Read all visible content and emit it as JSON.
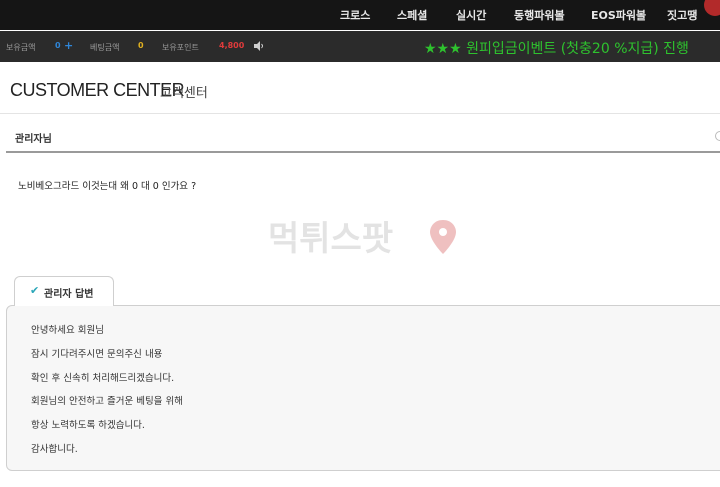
{
  "top_nav": {
    "items": [
      "크로스",
      "스페셜",
      "실시간",
      "동행파워볼",
      "EOS파워볼",
      "짓고땡"
    ]
  },
  "status_bar": {
    "balance_label": "보유금액",
    "balance_value": "0",
    "betting_label": "베팅금액",
    "betting_value": "0",
    "points_label": "보유포인트",
    "points_value": "4,800",
    "marquee": "★★★ 원피입금이벤트 (첫충20 %지급) 진행",
    "icons": [
      "plus-icon",
      "speaker-icon"
    ]
  },
  "page": {
    "title": "CUSTOMER CENTER",
    "subtitle": "고객센터"
  },
  "post": {
    "author": "관리자님",
    "question": "노비베오그라드 이것는대 왜 0 대 0 인가요 ?"
  },
  "watermark": {
    "text": "먹튀스팟"
  },
  "answer": {
    "tab_label": "관리자 답변",
    "lines": [
      "안녕하세요 회원님",
      "잠시 기다려주시면 문의주신 내용",
      "확인 후 신속히 처리해드리겠습니다.",
      "회원님의 안전하고 즐거운 베팅을 위해",
      "항상 노력하도록 하겠습니다.",
      "감사합니다."
    ]
  },
  "colors": {
    "nav_bg": "#151515",
    "status_bg": "#2b2b2b",
    "marquee": "#2ec22e",
    "points": "#e03b3b",
    "betting": "#e0b020",
    "accent": "#2f86d8",
    "check": "#2aa6b8"
  }
}
